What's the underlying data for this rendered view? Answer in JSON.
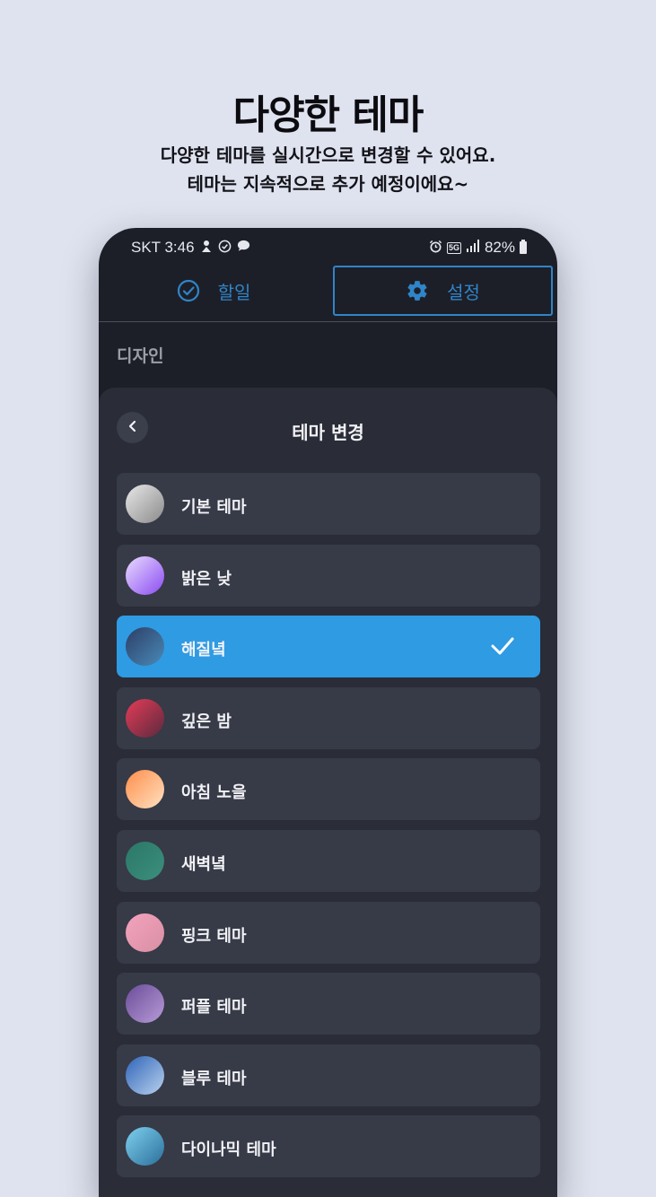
{
  "promo": {
    "title": "다양한 테마",
    "subtitle_line1": "다양한 테마를 실시간으로 변경할 수 있어요.",
    "subtitle_line2": "테마는 지속적으로 추가 예정이에요~"
  },
  "status_bar": {
    "carrier_time": "SKT 3:46",
    "network_badge": "5G",
    "battery_text": "82%"
  },
  "tabs": {
    "todo_label": "할일",
    "settings_label": "설정",
    "active": "settings"
  },
  "section_label": "디자인",
  "sheet": {
    "title": "테마 변경",
    "themes": [
      {
        "name": "기본 테마",
        "colors": [
          "#e8e8e8",
          "#8a8a8a"
        ],
        "selected": false
      },
      {
        "name": "밝은 낮",
        "colors": [
          "#e9dcff",
          "#8b4bf2"
        ],
        "selected": false
      },
      {
        "name": "해질녘",
        "colors": [
          "#2c3e66",
          "#4a8ab8"
        ],
        "selected": true
      },
      {
        "name": "깊은 밤",
        "colors": [
          "#e63b57",
          "#5a2a3e"
        ],
        "selected": false
      },
      {
        "name": "아침 노을",
        "colors": [
          "#ff8e4a",
          "#ffe1c2"
        ],
        "selected": false
      },
      {
        "name": "새벽녘",
        "colors": [
          "#2b7768",
          "#3c8f7c"
        ],
        "selected": false
      },
      {
        "name": "핑크 테마",
        "colors": [
          "#f4a3bd",
          "#d88fa4"
        ],
        "selected": false
      },
      {
        "name": "퍼플 테마",
        "colors": [
          "#6b4c9a",
          "#b79bd6"
        ],
        "selected": false
      },
      {
        "name": "블루 테마",
        "colors": [
          "#2f64b8",
          "#b9d2ee"
        ],
        "selected": false
      },
      {
        "name": "다이나믹 테마",
        "colors": [
          "#7fd0f0",
          "#2a6f9a"
        ],
        "selected": false
      }
    ]
  },
  "colors": {
    "accent": "#2f85c8",
    "selected_row": "#2f9be3",
    "page_background": "#dfe3ef",
    "phone_background": "#1d1f28",
    "sheet_background": "#2a2c37",
    "row_background": "#373a47"
  },
  "icons": {
    "tab_todo": "check-circle-icon",
    "tab_settings": "gear-icon",
    "back": "chevron-left-icon",
    "selected": "check-icon"
  }
}
